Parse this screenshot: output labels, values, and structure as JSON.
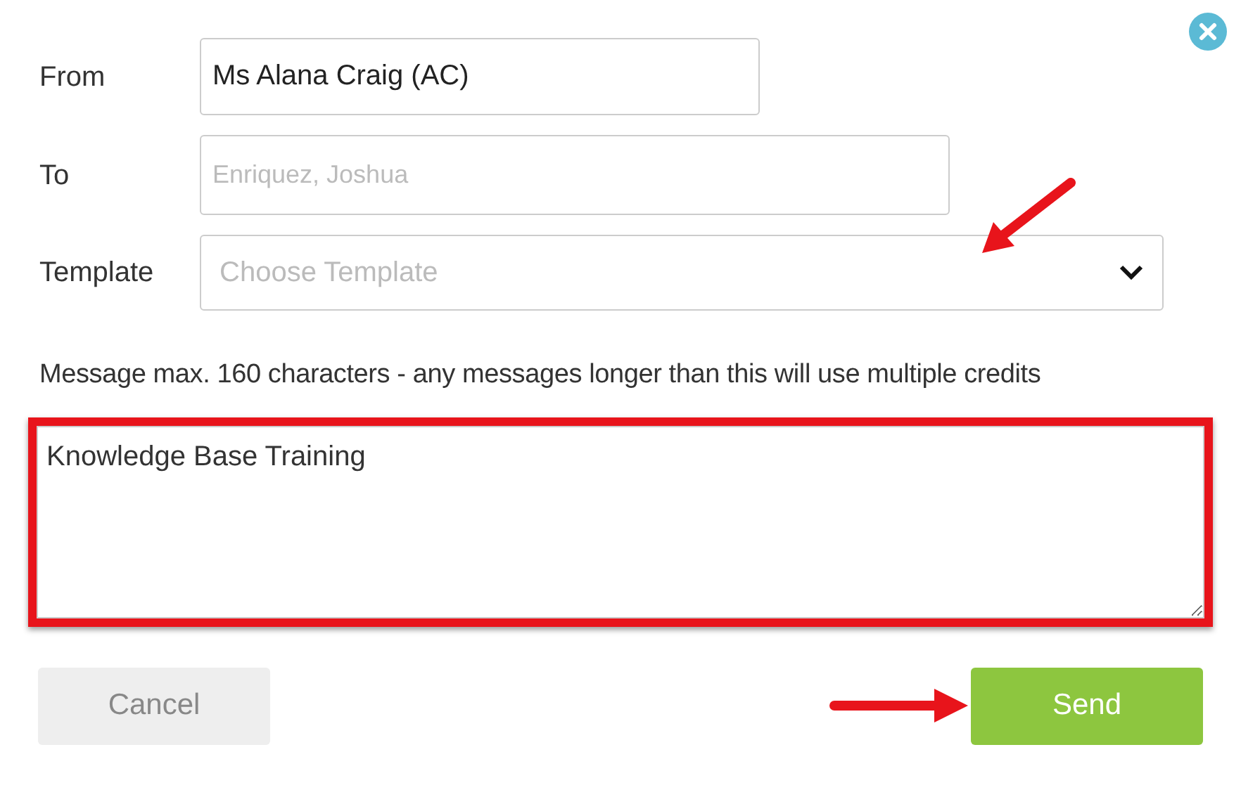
{
  "fields": [
    {
      "label": "From",
      "kind": "text",
      "value": "Ms Alana Craig (AC)"
    },
    {
      "label": "To",
      "kind": "text",
      "placeholder": "Enriquez, Joshua"
    },
    {
      "label": "Template",
      "kind": "select",
      "placeholder": "Choose Template"
    }
  ],
  "note": "Message max. 160 characters - any messages longer than this will use multiple credits",
  "message": {
    "value": "Knowledge Base Training"
  },
  "buttons": [
    {
      "label": "Cancel",
      "kind": "secondary"
    },
    {
      "label": "Send",
      "kind": "primary"
    }
  ]
}
